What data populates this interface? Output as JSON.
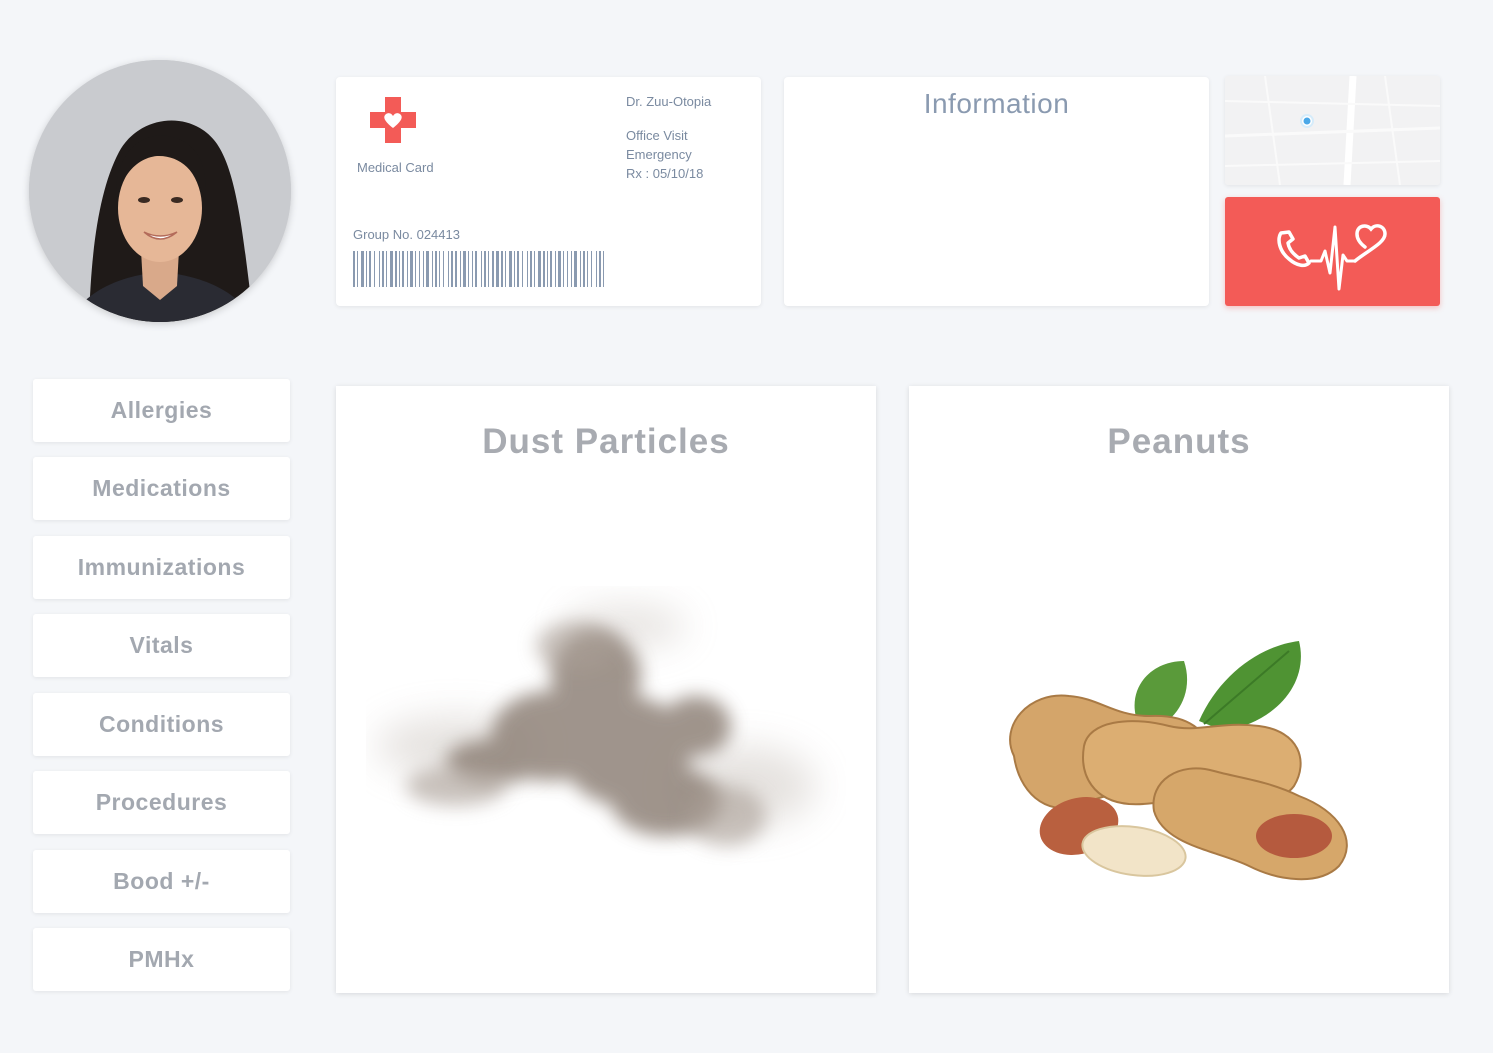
{
  "medical_card": {
    "title": "Medical Card",
    "doctor": "Dr. Zuu-Otopia",
    "visit_type": "Office Visit",
    "visit_priority": "Emergency",
    "rx_date": "Rx : 05/10/18",
    "group_number": "Group No. 024413"
  },
  "information": {
    "title": "Information"
  },
  "sidebar": {
    "items": [
      {
        "label": "Allergies"
      },
      {
        "label": "Medications"
      },
      {
        "label": "Immunizations"
      },
      {
        "label": "Vitals"
      },
      {
        "label": "Conditions"
      },
      {
        "label": "Procedures"
      },
      {
        "label": "Bood +/-"
      },
      {
        "label": "PMHx"
      }
    ]
  },
  "allergies": [
    {
      "name": "Dust Particles"
    },
    {
      "name": "Peanuts"
    }
  ],
  "icons": {
    "medical": "medical-cross-heart-icon",
    "call": "phone-heartbeat-icon",
    "map_pin": "location-pin-icon"
  },
  "colors": {
    "accent_red": "#f35b57",
    "text_muted": "#7a8aa0"
  }
}
